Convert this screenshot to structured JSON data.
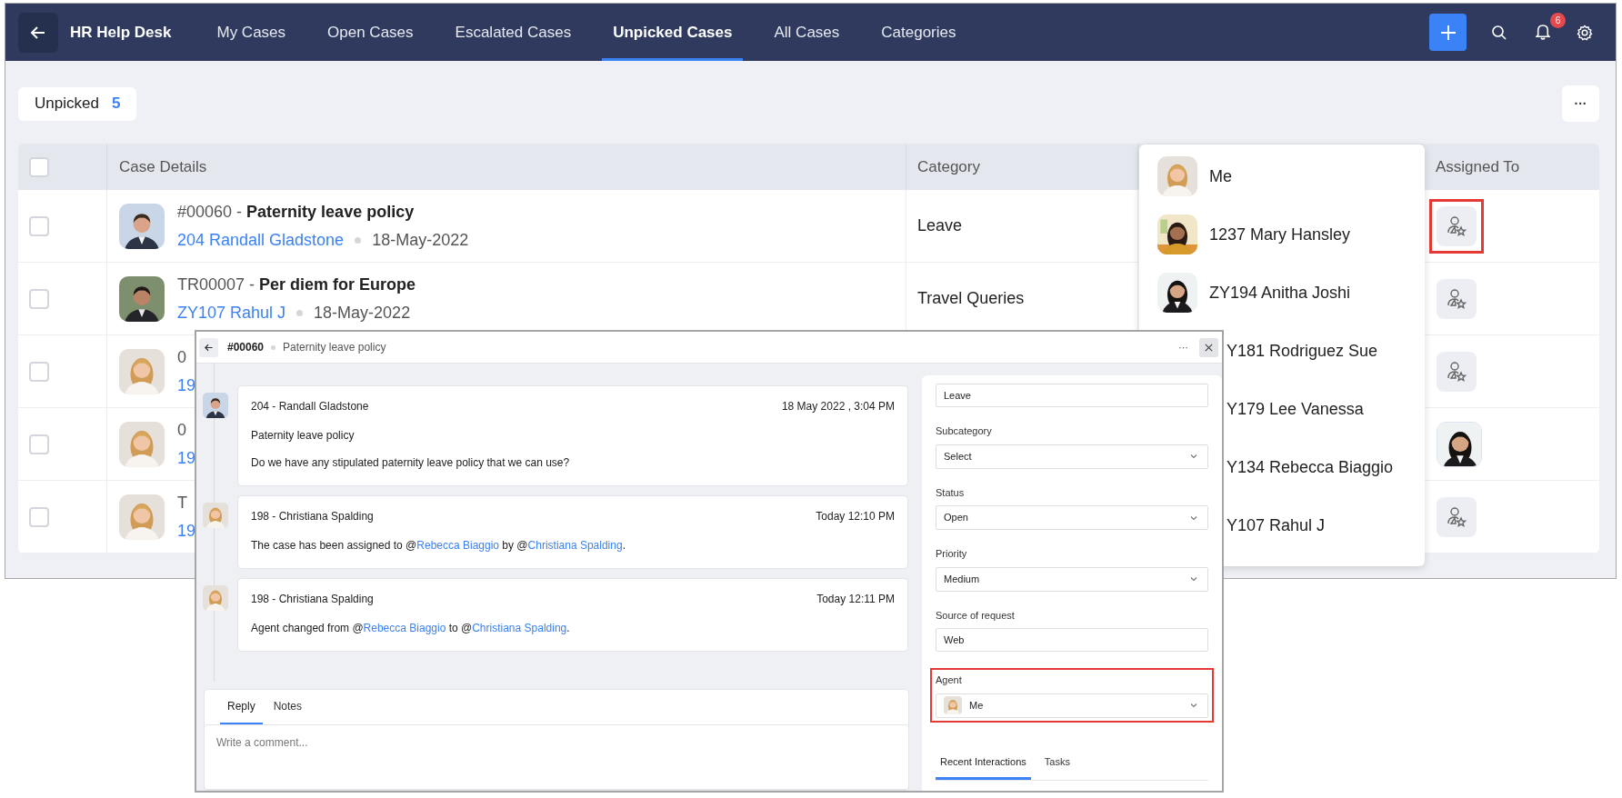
{
  "nav": {
    "title": "HR Help Desk",
    "tabs": [
      {
        "label": "My Cases",
        "selected": false
      },
      {
        "label": "Open Cases",
        "selected": false
      },
      {
        "label": "Escalated Cases",
        "selected": false
      },
      {
        "label": "Unpicked Cases",
        "selected": true
      },
      {
        "label": "All Cases",
        "selected": false
      },
      {
        "label": "Categories",
        "selected": false
      }
    ],
    "notification_count": "6"
  },
  "view": {
    "label": "Unpicked",
    "count": "5",
    "more": "···"
  },
  "table": {
    "header_checked": false,
    "columns": [
      "Case Details",
      "Category",
      "Assigned To"
    ],
    "rows": [
      {
        "checked": false,
        "id": "#00060",
        "separator": "-",
        "subject": "Paternity leave policy",
        "requester": "204 Randall Gladstone",
        "date": "18-May-2022",
        "category": "Leave",
        "assignee": {
          "kind": "icon",
          "highlighted": true
        }
      },
      {
        "checked": false,
        "id": "TR00007",
        "separator": "-",
        "subject": "Per diem for Europe",
        "requester": "ZY107 Rahul J",
        "date": "18-May-2022",
        "category": "Travel Queries",
        "assignee": {
          "kind": "icon",
          "highlighted": false
        }
      },
      {
        "checked": false,
        "id": "0",
        "requester": "19",
        "assignee": {
          "kind": "icon",
          "highlighted": false
        }
      },
      {
        "checked": false,
        "id": "0",
        "requester": "19"
      },
      {
        "checked": false,
        "id": "T",
        "requester": "19",
        "assignee": {
          "kind": "icon",
          "highlighted": false
        }
      }
    ]
  },
  "agent_menu": {
    "items": [
      {
        "name": "Me",
        "photo": true
      },
      {
        "name": "1237 Mary Hansley",
        "photo": true
      },
      {
        "name": "ZY194 Anitha Joshi",
        "photo": true
      },
      {
        "name": "Y181 Rodriguez Sue",
        "photo": false
      },
      {
        "name": "Y179 Lee Vanessa",
        "photo": false
      },
      {
        "name": "Y134 Rebecca Biaggio",
        "photo": false
      },
      {
        "name": "Y107 Rahul J",
        "photo": false
      }
    ]
  },
  "case_window": {
    "id": "#00060",
    "subject": "Paternity leave policy",
    "more": "···",
    "thread": [
      {
        "author": "204 - Randall Gladstone",
        "time": "18 May 2022 , 3:04 PM",
        "paragraphs": [
          [
            {
              "text": "Paternity leave policy"
            }
          ],
          [
            {
              "text": "Do we have any stipulated paternity leave policy that we can use?"
            }
          ]
        ]
      },
      {
        "author": "198 - Christiana Spalding",
        "time": "Today 12:10 PM",
        "paragraphs": [
          [
            {
              "text": "The case has been assigned to @"
            },
            {
              "text": "Rebecca Biaggio",
              "link": true
            },
            {
              "text": " by @"
            },
            {
              "text": "Christiana Spalding",
              "link": true
            },
            {
              "text": "."
            }
          ]
        ]
      },
      {
        "author": "198 - Christiana Spalding",
        "time": "Today 12:11 PM",
        "paragraphs": [
          [
            {
              "text": "Agent changed from @"
            },
            {
              "text": "Rebecca Biaggio",
              "link": true
            },
            {
              "text": " to @"
            },
            {
              "text": "Christiana Spalding",
              "link": true
            },
            {
              "text": "."
            }
          ]
        ]
      }
    ],
    "reply_tabs": [
      {
        "label": "Reply",
        "selected": true
      },
      {
        "label": "Notes",
        "selected": false
      }
    ],
    "comment_placeholder": "Write a comment...",
    "fields": [
      {
        "kind": "text",
        "value": "Leave",
        "highlighted": false
      },
      {
        "kind": "select",
        "label": "Subcategory",
        "value": "Select",
        "highlighted": false
      },
      {
        "kind": "select",
        "label": "Status",
        "value": "Open",
        "highlighted": false
      },
      {
        "kind": "select",
        "label": "Priority",
        "value": "Medium",
        "highlighted": false
      },
      {
        "kind": "text",
        "label": "Source of request",
        "value": "Web",
        "highlighted": false
      },
      {
        "kind": "select",
        "label": "Agent",
        "value": "Me",
        "avatar": true,
        "highlighted": true
      }
    ],
    "side_tabs": [
      {
        "label": "Recent Interactions",
        "selected": true
      },
      {
        "label": "Tasks",
        "selected": false
      }
    ]
  }
}
